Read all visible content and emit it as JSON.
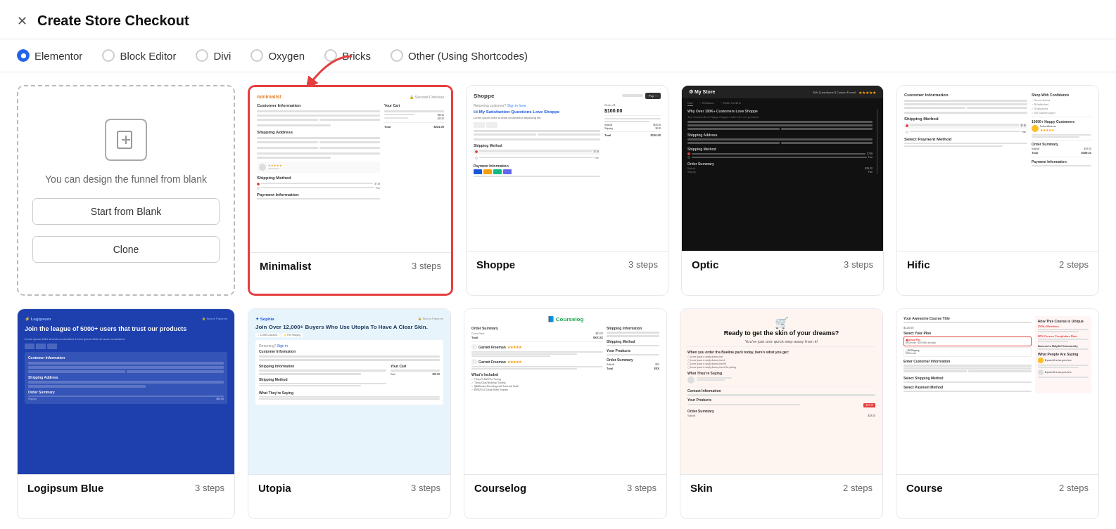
{
  "header": {
    "title": "Create Store Checkout",
    "close_label": "×"
  },
  "radio_options": [
    {
      "id": "elementor",
      "label": "Elementor",
      "selected": true
    },
    {
      "id": "block-editor",
      "label": "Block Editor",
      "selected": false
    },
    {
      "id": "divi",
      "label": "Divi",
      "selected": false
    },
    {
      "id": "oxygen",
      "label": "Oxygen",
      "selected": false
    },
    {
      "id": "bricks",
      "label": "Bricks",
      "selected": false
    },
    {
      "id": "other",
      "label": "Other (Using Shortcodes)",
      "selected": false
    }
  ],
  "blank_card": {
    "description": "You can design the funnel from blank",
    "start_label": "Start from Blank",
    "clone_label": "Clone"
  },
  "templates_row1": [
    {
      "name": "Minimalist",
      "steps": "3 steps",
      "selected": true
    },
    {
      "name": "Shoppe",
      "steps": "3 steps",
      "selected": false
    },
    {
      "name": "Optic",
      "steps": "3 steps",
      "selected": false
    },
    {
      "name": "Hific",
      "steps": "2 steps",
      "selected": false
    }
  ],
  "templates_row2": [
    {
      "name": "Logipsum Blue",
      "steps": "3 steps",
      "selected": false
    },
    {
      "name": "Utopia",
      "steps": "3 steps",
      "selected": false
    },
    {
      "name": "Courselog",
      "steps": "3 steps",
      "selected": false
    },
    {
      "name": "Skin",
      "steps": "2 steps",
      "selected": false
    },
    {
      "name": "Course",
      "steps": "2 steps",
      "selected": false
    }
  ],
  "colors": {
    "selected_border": "#e53e3e",
    "primary_blue": "#2563eb",
    "accent_red": "#e53e3e"
  }
}
